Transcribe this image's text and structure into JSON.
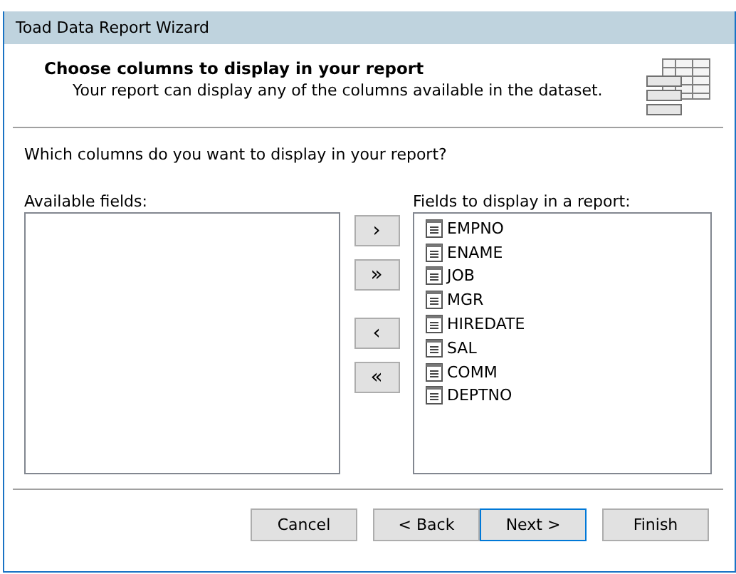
{
  "window": {
    "title": "Toad Data Report Wizard"
  },
  "header": {
    "title": "Choose columns to display in your report",
    "subtitle": "Your report can display any of the columns available in the dataset."
  },
  "question": "Which columns do you want to display in your report?",
  "available": {
    "label": "Available fields:"
  },
  "move_buttons": [
    "›",
    "»",
    "‹",
    "«"
  ],
  "selected_fields": {
    "label": "Fields to display in a report:",
    "items": [
      "EMPNO",
      "ENAME",
      "JOB",
      "MGR",
      "HIREDATE",
      "SAL",
      "COMM",
      "DEPTNO"
    ]
  },
  "buttons": [
    {
      "label": "Cancel",
      "focused": false
    },
    {
      "label": "< Back",
      "focused": false
    },
    {
      "label": "Next >",
      "focused": true
    },
    {
      "label": "Finish",
      "focused": false
    }
  ]
}
